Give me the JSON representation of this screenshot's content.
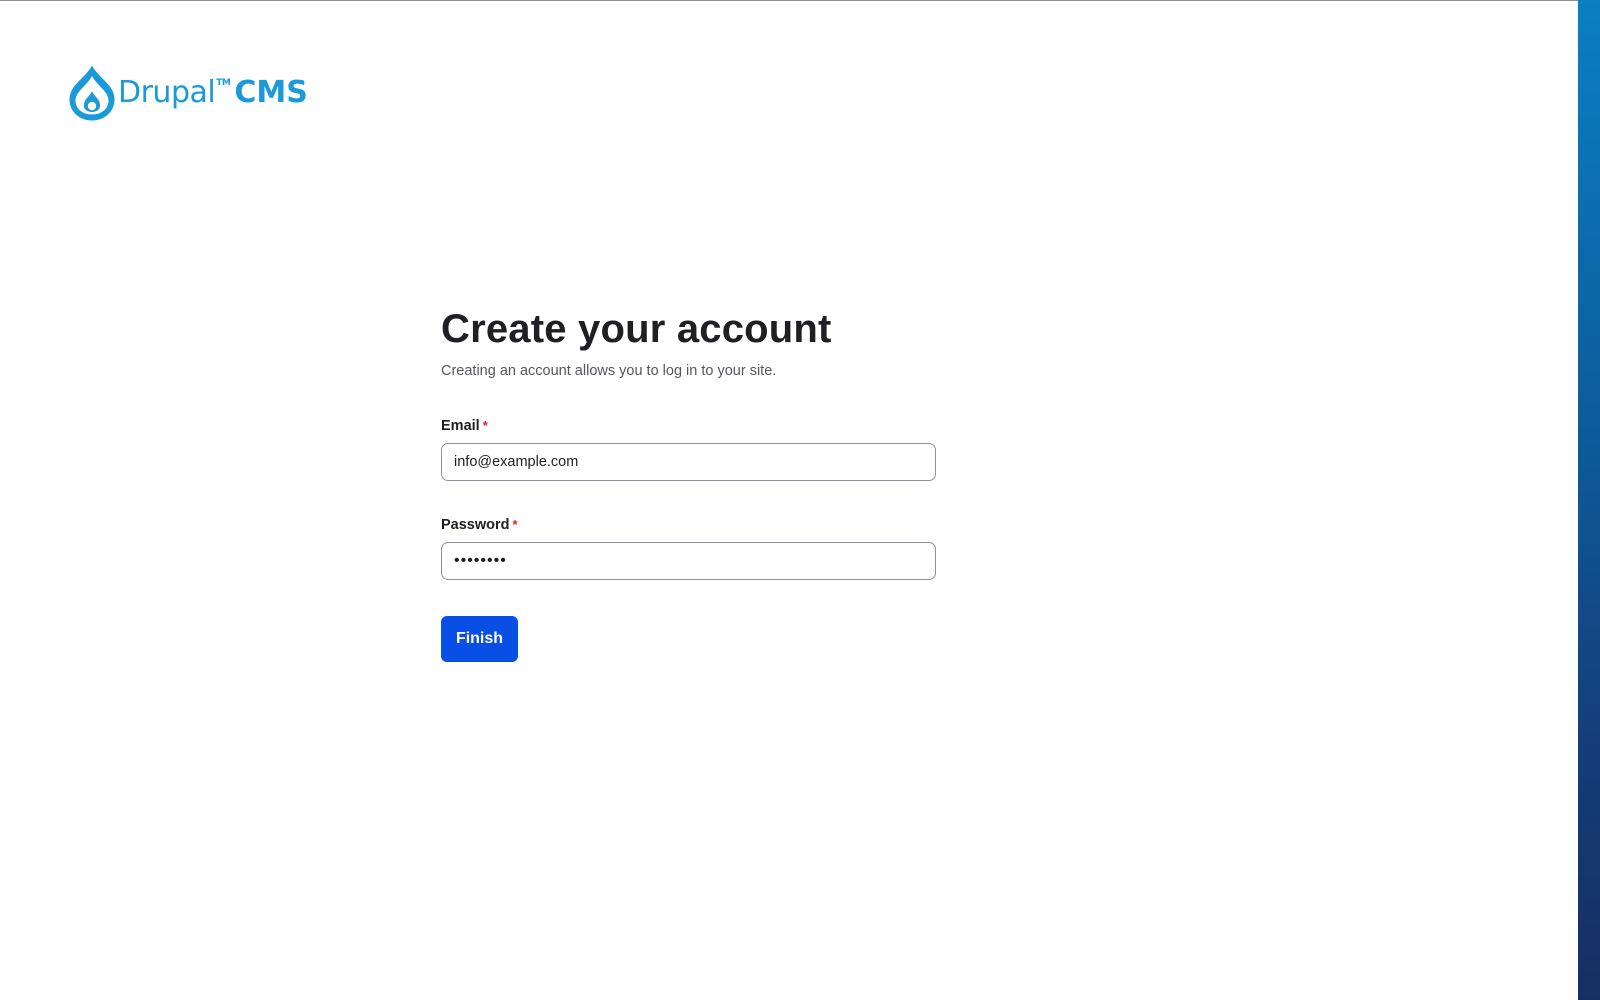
{
  "brand": {
    "name": "Drupal",
    "trademark": "TM",
    "product": "CMS",
    "logo_icon": "drupal-drop-icon",
    "color": "#1b9ad8"
  },
  "form": {
    "title": "Create your account",
    "subtitle": "Creating an account allows you to log in to your site.",
    "required_mark": "*",
    "email": {
      "label": "Email",
      "value": "info@example.com"
    },
    "password": {
      "label": "Password",
      "value": "••••••••"
    },
    "submit_label": "Finish"
  },
  "colors": {
    "button": "#0a4fe5",
    "required": "#d72222",
    "side_stripe_top": "#0a7fc2",
    "side_stripe_bottom": "#162f63"
  }
}
